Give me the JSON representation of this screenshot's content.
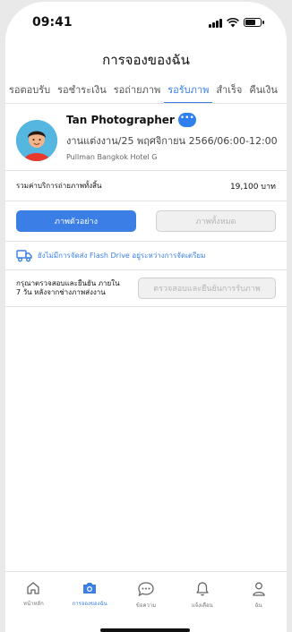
{
  "status": {
    "time": "09:41"
  },
  "header": {
    "title": "การจองของฉัน"
  },
  "tabs": [
    {
      "label": "รอตอบรับ"
    },
    {
      "label": "รอชำระเงิน"
    },
    {
      "label": "รอถ่ายภาพ"
    },
    {
      "label": "รอรับภาพ",
      "active": true
    },
    {
      "label": "สำเร็จ"
    },
    {
      "label": "คืนเงิน"
    }
  ],
  "booking": {
    "photographer_name": "Tan Photographer",
    "details": "งานแต่งงาน/25 พฤศจิกายน 2566/06:00-12:00 น.",
    "venue": "Pullman Bangkok Hotel G",
    "total_label": "รวมค่าบริการถ่ายภาพทั้งสิ้น",
    "total_amount": "19,100 บาท"
  },
  "buttons": {
    "sample_photos": "ภาพตัวอย่าง",
    "all_photos": "ภาพทั้งหมด",
    "confirm_receipt": "ตรวจสอบและยืนยันการรับภาพ"
  },
  "notice": {
    "text": "ยังไม่มีการจัดส่ง Flash Drive อยู่ระหว่างการจัดเตรียม"
  },
  "confirm": {
    "text": "กรุณาตรวจสอบและยืนยัน ภายใน 7 วัน หลังจากช่างภาพส่งงาน"
  },
  "bottom_nav": [
    {
      "label": "หน้าหลัก",
      "icon": "home-icon"
    },
    {
      "label": "การจองของฉัน",
      "icon": "camera-icon",
      "active": true
    },
    {
      "label": "ข้อความ",
      "icon": "chat-icon"
    },
    {
      "label": "แจ้งเตือน",
      "icon": "bell-icon"
    },
    {
      "label": "ฉัน",
      "icon": "user-icon"
    }
  ],
  "colors": {
    "accent": "#3b7fe6"
  }
}
